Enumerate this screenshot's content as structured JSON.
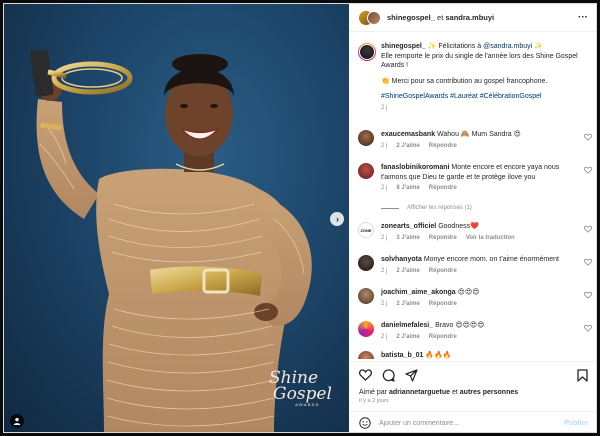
{
  "colors": {
    "accent_link": "#00376b",
    "publish_disabled": "#b2dffc",
    "meta_gray": "#8e8e8e",
    "heart_red": "#ed4956"
  },
  "post": {
    "header": {
      "user1": "shinegospel_",
      "joiner": " et ",
      "user2": "sandra.mbuyi"
    },
    "more_icon": "ellipsis-icon",
    "photo": {
      "watermark_line1": "Shine",
      "watermark_line2": "Gospel",
      "watermark_line3": "AWARDS"
    },
    "caption": {
      "username": "shinegospel_",
      "line1_a": " ✨ Félicitations à ",
      "mention": "@sandra.mbuyi",
      "line1_b": " ✨",
      "line2": "Elle remporte le prix du single de l'année lors des Shine Gospel Awards !",
      "thanks": "👏 Merci pour sa contribution au gospel francophone.",
      "hashtags": "#ShineGospelAwards #Lauréat #CélébrationGospel",
      "time": "2 j"
    },
    "comments": [
      {
        "username": "exaucemasbank",
        "text": "Wahou 🙈 Mum Sandra 😍",
        "time": "2 j",
        "likes": "2 J'aime",
        "reply": "Répondre",
        "translate": ""
      },
      {
        "username": "fanaslobinikoromani",
        "text": "Monte encore et encore yaya nous t'aimons que Dieu te garde et te protège ilove you",
        "time": "2 j",
        "likes": "8 J'aime",
        "reply": "Répondre",
        "translate": ""
      },
      {
        "username": "zonearts_officiel",
        "text": "Goodness❤️",
        "time": "2 j",
        "likes": "3 J'aime",
        "reply": "Répondre",
        "translate": "Voir la traduction"
      },
      {
        "username": "solvhanyota",
        "text": "Monye encore mom. on t'aime énormément",
        "time": "2 j",
        "likes": "2 J'aime",
        "reply": "Répondre",
        "translate": ""
      },
      {
        "username": "joachim_aime_akonga",
        "text": "😍😍😍",
        "time": "2 j",
        "likes": "2 J'aime",
        "reply": "Répondre",
        "translate": ""
      },
      {
        "username": "danielmefalesi_",
        "text": "Bravo 😍😍😍😍",
        "time": "2 j",
        "likes": "2 J'aime",
        "reply": "Répondre",
        "translate": ""
      },
      {
        "username": "batista_b_01",
        "text": "🔥🔥🔥",
        "time": "",
        "likes": "",
        "reply": "",
        "translate": ""
      }
    ],
    "view_replies": "Afficher les réponses (1)",
    "footer": {
      "liked_prefix": "Aimé par ",
      "liked_user": "adriannetarguetue",
      "liked_suffix": " et ",
      "liked_others": "autres personnes",
      "ago": "Il y a 2 jours"
    },
    "comment_input": {
      "placeholder": "Ajouter un commentaire...",
      "publish": "Publier"
    }
  }
}
